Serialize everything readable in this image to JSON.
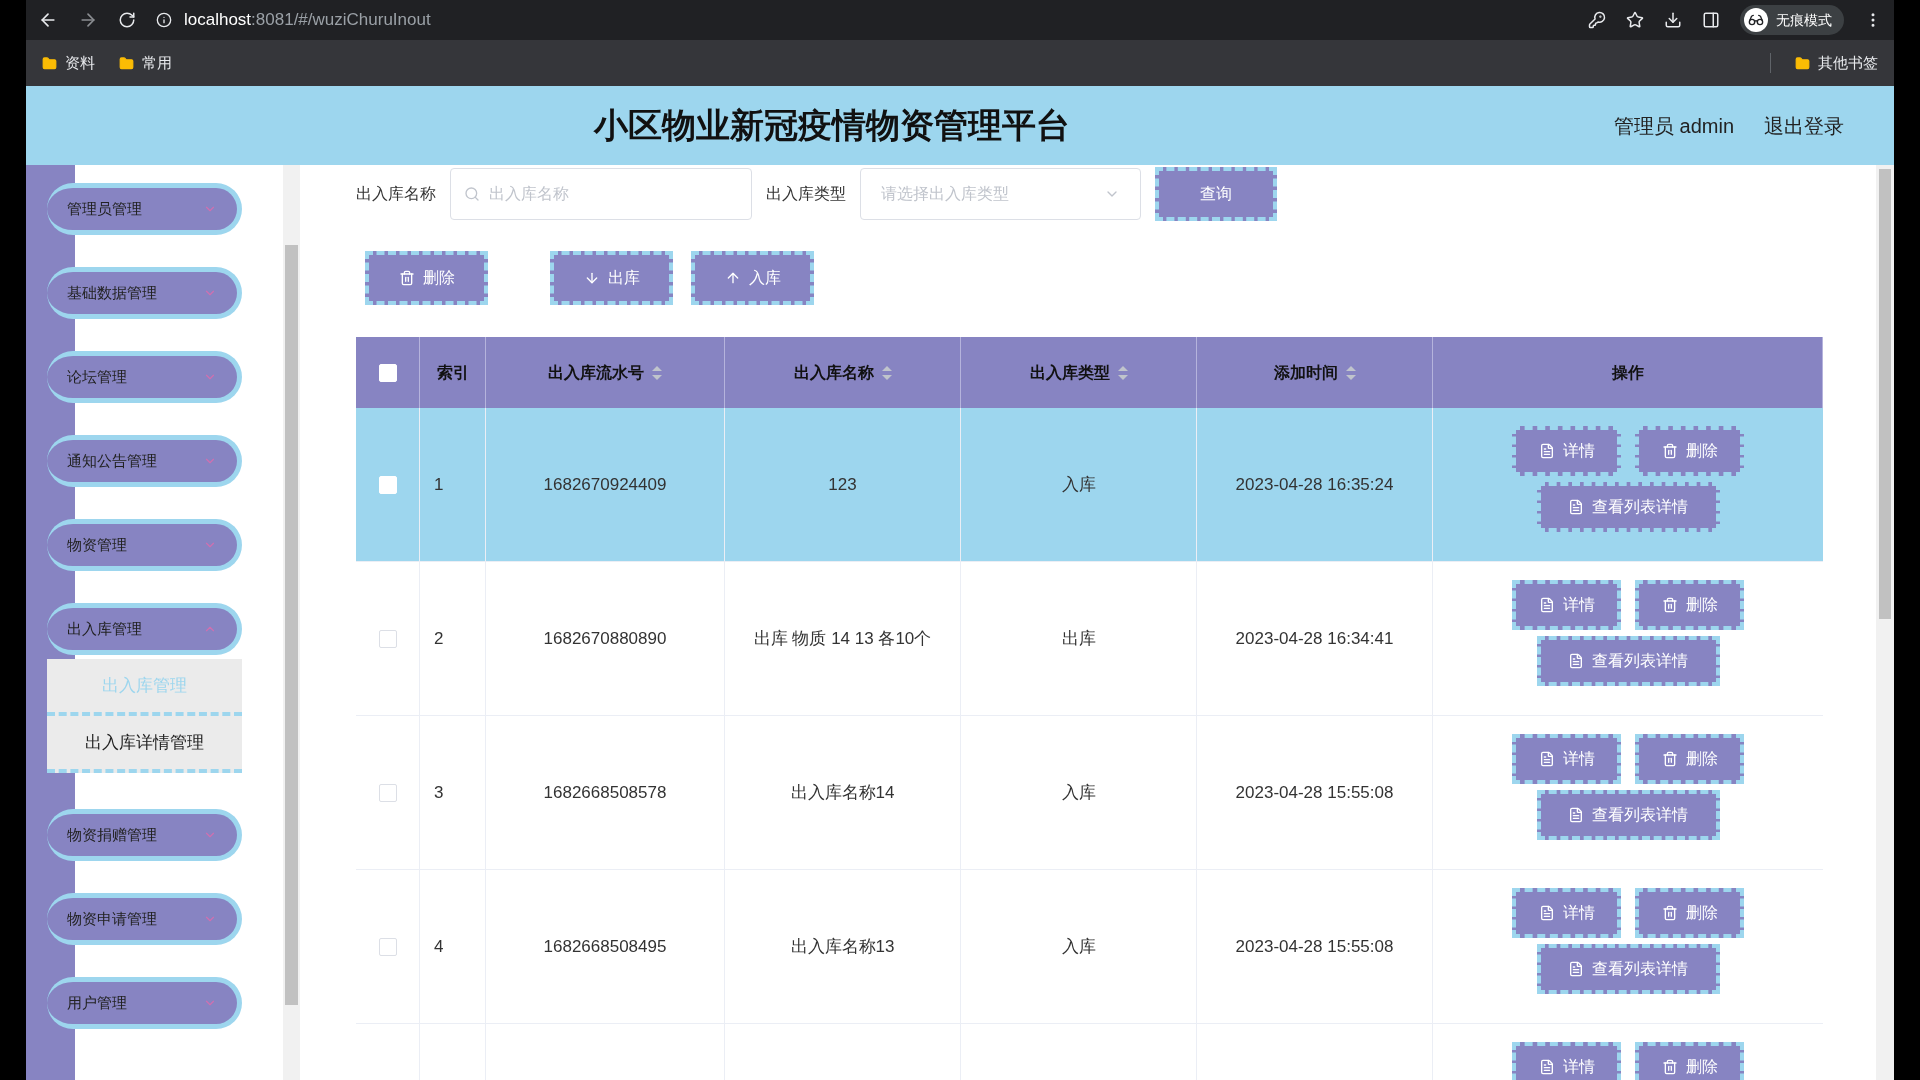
{
  "browser": {
    "url_host": "localhost",
    "url_rest": ":8081/#/wuziChuruInout",
    "profile": "无痕模式",
    "bookmarks": [
      "资料",
      "常用"
    ],
    "other_bookmarks": "其他书签"
  },
  "header": {
    "title": "小区物业新冠疫情物资管理平台",
    "user": "管理员 admin",
    "logout": "退出登录"
  },
  "sidebar": {
    "items": [
      {
        "label": "管理员管理",
        "expanded": false
      },
      {
        "label": "基础数据管理",
        "expanded": false
      },
      {
        "label": "论坛管理",
        "expanded": false
      },
      {
        "label": "通知公告管理",
        "expanded": false
      },
      {
        "label": "物资管理",
        "expanded": false
      },
      {
        "label": "出入库管理",
        "expanded": true,
        "children": [
          {
            "label": "出入库管理",
            "selected": true
          },
          {
            "label": "出入库详情管理",
            "selected": false
          }
        ]
      },
      {
        "label": "物资捐赠管理",
        "expanded": false
      },
      {
        "label": "物资申请管理",
        "expanded": false
      },
      {
        "label": "用户管理",
        "expanded": false
      }
    ]
  },
  "filters": [
    {
      "kind": "input",
      "label": "出入库名称",
      "placeholder": "出入库名称"
    },
    {
      "kind": "select",
      "label": "出入库类型",
      "placeholder": "请选择出入库类型"
    }
  ],
  "search_button": "查询",
  "toolbar": [
    {
      "kind": "delete",
      "label": "删除"
    },
    {
      "kind": "out",
      "label": "出库"
    },
    {
      "kind": "in",
      "label": "入库"
    }
  ],
  "table": {
    "columns": [
      {
        "kind": "checkbox",
        "checked": false
      },
      {
        "kind": "text",
        "label": "索引",
        "sortable": false
      },
      {
        "kind": "text",
        "label": "出入库流水号",
        "sortable": true
      },
      {
        "kind": "text",
        "label": "出入库名称",
        "sortable": true
      },
      {
        "kind": "text",
        "label": "出入库类型",
        "sortable": true
      },
      {
        "kind": "text",
        "label": "添加时间",
        "sortable": true
      },
      {
        "kind": "text",
        "label": "操作",
        "sortable": false
      }
    ],
    "rows": [
      {
        "selected": true,
        "checked": false,
        "cells": [
          "1",
          "1682670924409",
          "123",
          "入库",
          "2023-04-28 16:35:24"
        ],
        "actions": [
          {
            "kind": "detail",
            "label": "详情"
          },
          {
            "kind": "delete",
            "label": "删除"
          },
          {
            "kind": "detail",
            "label": "查看列表详情"
          }
        ]
      },
      {
        "selected": false,
        "checked": false,
        "cells": [
          "2",
          "1682670880890",
          "出库 物质 14 13 各10个",
          "出库",
          "2023-04-28 16:34:41"
        ],
        "actions": [
          {
            "kind": "detail",
            "label": "详情"
          },
          {
            "kind": "delete",
            "label": "删除"
          },
          {
            "kind": "detail",
            "label": "查看列表详情"
          }
        ]
      },
      {
        "selected": false,
        "checked": false,
        "cells": [
          "3",
          "1682668508578",
          "出入库名称14",
          "入库",
          "2023-04-28 15:55:08"
        ],
        "actions": [
          {
            "kind": "detail",
            "label": "详情"
          },
          {
            "kind": "delete",
            "label": "删除"
          },
          {
            "kind": "detail",
            "label": "查看列表详情"
          }
        ]
      },
      {
        "selected": false,
        "checked": false,
        "cells": [
          "4",
          "1682668508495",
          "出入库名称13",
          "入库",
          "2023-04-28 15:55:08"
        ],
        "actions": [
          {
            "kind": "detail",
            "label": "详情"
          },
          {
            "kind": "delete",
            "label": "删除"
          },
          {
            "kind": "detail",
            "label": "查看列表详情"
          }
        ]
      },
      {
        "selected": false,
        "actions": [
          {
            "kind": "detail",
            "label": "详情"
          },
          {
            "kind": "delete",
            "label": "删除"
          }
        ]
      }
    ]
  }
}
